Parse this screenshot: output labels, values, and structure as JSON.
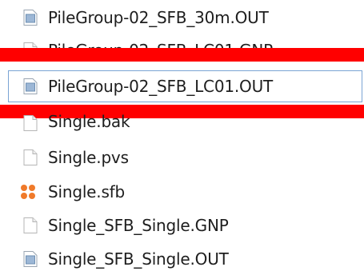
{
  "files": [
    {
      "name": "PileGroup-02_SFB_30m.OUT",
      "icon": "out-file-icon",
      "selected": false
    },
    {
      "name": "PileGroup-02_SFB_LC01.GNP",
      "icon": "blank-file-icon",
      "selected": false
    },
    {
      "name": "PileGroup-02_SFB_LC01.OUT",
      "icon": "out-file-icon",
      "selected": true
    },
    {
      "name": "Single.bak",
      "icon": "blank-file-icon",
      "selected": false
    },
    {
      "name": "Single.pvs",
      "icon": "blank-file-icon",
      "selected": false
    },
    {
      "name": "Single.sfb",
      "icon": "sfb-app-icon",
      "selected": false
    },
    {
      "name": "Single_SFB_Single.GNP",
      "icon": "blank-file-icon",
      "selected": false
    },
    {
      "name": "Single_SFB_Single.OUT",
      "icon": "out-file-icon",
      "selected": false
    }
  ],
  "colors": {
    "redact": "#ff0000",
    "selection_border": "#7aa4d4",
    "sfb_icon": "#f07a2a"
  }
}
